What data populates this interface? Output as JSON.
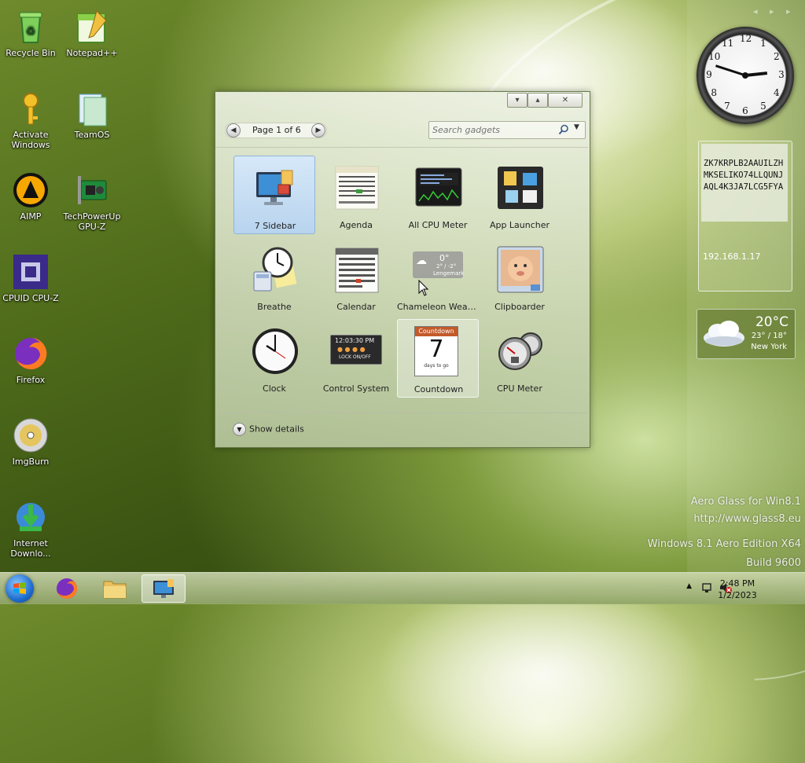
{
  "desktop_icons": [
    {
      "label": "Recycle Bin"
    },
    {
      "label": "Notepad++"
    },
    {
      "label": "Activate Windows"
    },
    {
      "label": "TeamOS"
    },
    {
      "label": "AIMP"
    },
    {
      "label": "TechPowerUp GPU-Z"
    },
    {
      "label": "CPUID CPU-Z"
    },
    {
      "label": "Firefox"
    },
    {
      "label": "ImgBurn"
    },
    {
      "label": "Internet Downlo..."
    }
  ],
  "sidebar": {
    "clock": {
      "numbers": [
        "12",
        "1",
        "2",
        "3",
        "4",
        "5",
        "6",
        "7",
        "8",
        "9",
        "10",
        "11"
      ],
      "hour": 2,
      "minute": 48
    },
    "note": {
      "key": "ZK7KRPLB2AAUILZHMKSELIKO74LLQUNJAQL4K3JA7LCG5FYA",
      "ip": "192.168.1.17"
    },
    "weather": {
      "temp": "20°C",
      "range": "23° / 18°",
      "city": "New York"
    }
  },
  "watermark": {
    "line1": "Aero Glass for Win8.1",
    "line2": "http://www.glass8.eu",
    "line3": "Windows 8.1 Aero Edition X64",
    "line4": "Build 9600"
  },
  "gallery": {
    "pager_text": "Page 1 of 6",
    "search_placeholder": "Search gadgets",
    "show_details": "Show details",
    "gadgets": [
      {
        "label": "7 Sidebar"
      },
      {
        "label": "Agenda"
      },
      {
        "label": "All CPU Meter"
      },
      {
        "label": "App Launcher"
      },
      {
        "label": "Breathe"
      },
      {
        "label": "Calendar"
      },
      {
        "label": "Chameleon Weat..."
      },
      {
        "label": "Clipboarder"
      },
      {
        "label": "Clock"
      },
      {
        "label": "Control System"
      },
      {
        "label": "Countdown"
      },
      {
        "label": "CPU Meter"
      }
    ],
    "countdown": {
      "title": "Countdown",
      "number": "7",
      "sub": "days to go"
    },
    "weather_tile": {
      "temp": "0°",
      "range": "2° / -2°",
      "place": "Lengemark"
    },
    "control_time": "12:03:30 PM",
    "control_lock": "LOCK ON/OFF"
  },
  "taskbar": {
    "time": "2:48 PM",
    "date": "1/2/2023"
  }
}
